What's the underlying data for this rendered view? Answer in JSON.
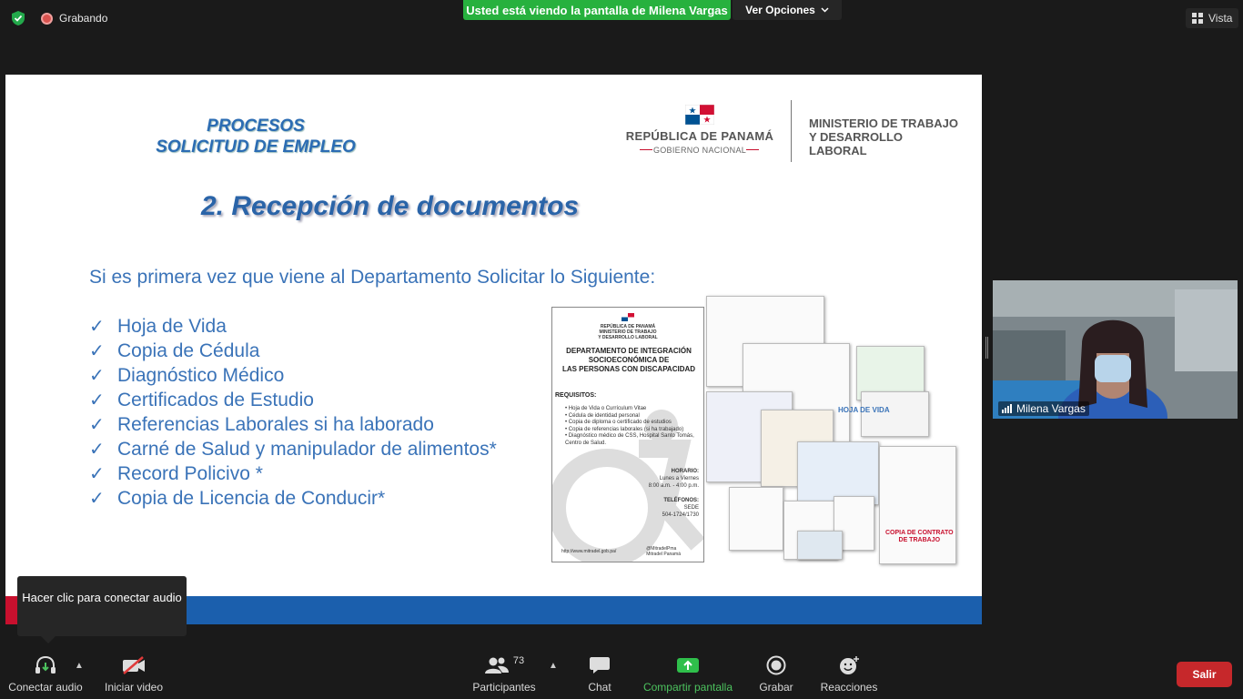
{
  "topbar": {
    "recording_label": "Grabando",
    "viewing_banner": "Usted está viendo la pantalla de Milena Vargas",
    "options_label": "Ver Opciones",
    "view_label": "Vista"
  },
  "slide": {
    "process_title_line1": "PROCESOS",
    "process_title_line2": "SOLICITUD DE EMPLEO",
    "republic_label": "REPÚBLICA DE PANAMÁ",
    "government_label": "GOBIERNO NACIONAL",
    "ministry_line1": "MINISTERIO DE TRABAJO",
    "ministry_line2": "Y DESARROLLO LABORAL",
    "heading": "2. Recepción de documentos",
    "intro": "Si es primera vez que viene al Departamento Solicitar lo Siguiente:",
    "checkmark": "✓",
    "items": [
      "Hoja de Vida",
      "Copia de Cédula",
      "Diagnóstico Médico",
      "Certificados de Estudio",
      "Referencias Laborales si ha laborado",
      "Carné de Salud y manipulador de alimentos*",
      "Record Policivo *",
      "Copia de Licencia de Conducir*"
    ],
    "flyer": {
      "header_line1": "REPÚBLICA DE PANAMÁ",
      "header_line2": "MINISTERIO DE TRABAJO",
      "header_line3": "Y DESARROLLO LABORAL",
      "title_line1": "DEPARTAMENTO DE INTEGRACIÓN",
      "title_line2": "SOCIOECONÓMICA DE",
      "title_line3": "LAS PERSONAS CON DISCAPACIDAD",
      "requisitos": "REQUISITOS:",
      "req_items": [
        "Hoja de Vida o Currículum Vitae",
        "Cédula de identidad personal",
        "Copia de diploma o certificado de estudios",
        "Copia de referencias laborales (si ha trabajado)",
        "Diagnóstico médico de CSS, Hospital Santo Tomás, Centro de Salud."
      ],
      "horario_label": "HORARIO:",
      "horario_days": "Lunes a Viernes",
      "horario_hours": "8:00 a.m. - 4:00 p.m.",
      "telefonos_label": "TELÉFONOS:",
      "telefonos_sede": "SEDE",
      "telefonos_number": "504-1724/1730",
      "website": "http://www.mitradel.gob.pa/",
      "social_line1": "@MitradelPma",
      "social_line2": "Mitradel Panamá"
    },
    "collage_hoja_vida": "HOJA DE VIDA",
    "collage_contract_line1": "COPIA DE CONTRATO",
    "collage_contract_line2": "DE TRABAJO"
  },
  "participant_video": {
    "name": "Milena Vargas"
  },
  "tooltip": {
    "text": "Hacer clic para conectar audio"
  },
  "toolbar": {
    "connect_audio": "Conectar audio",
    "start_video": "Iniciar video",
    "participants": "Participantes",
    "participants_count": "73",
    "chat": "Chat",
    "share_screen": "Compartir pantalla",
    "record": "Grabar",
    "reactions": "Reacciones",
    "leave": "Salir"
  },
  "colors": {
    "banner_green": "#27b13e",
    "slide_blue": "#3a73b8",
    "leave_red": "#c6282b"
  }
}
